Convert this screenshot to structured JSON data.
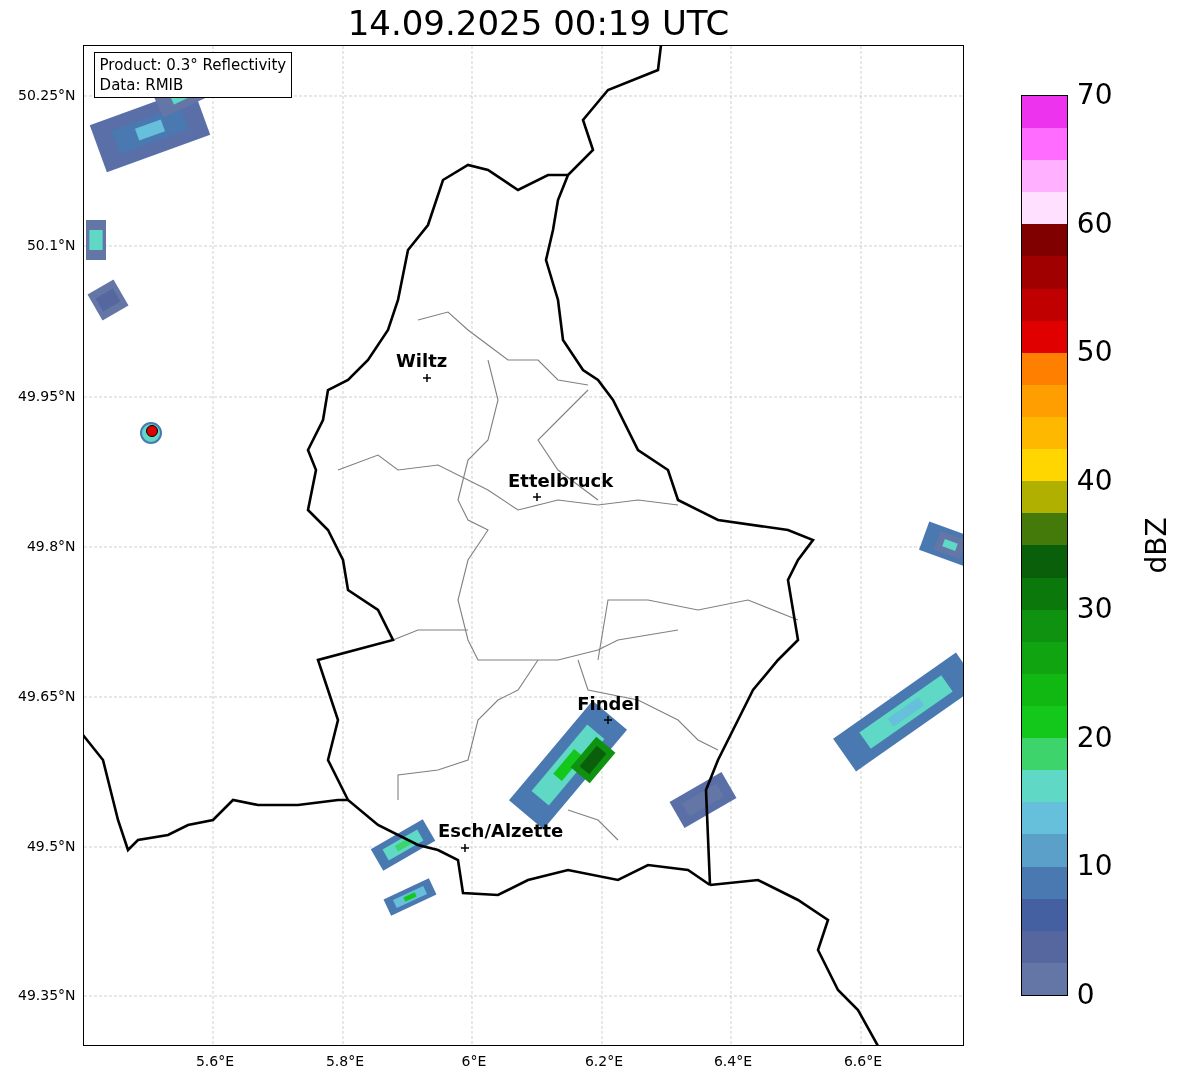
{
  "title": "14.09.2025 00:19 UTC",
  "info_box": {
    "lines": [
      "Product: 0.3° Reflectivity",
      "Data: RMIB"
    ]
  },
  "y_ticks": [
    "50.25°N",
    "50.1°N",
    "49.95°N",
    "49.8°N",
    "49.65°N",
    "49.5°N",
    "49.35°N"
  ],
  "x_ticks": [
    "5.6°E",
    "5.8°E",
    "6°E",
    "6.2°E",
    "6.4°E",
    "6.6°E"
  ],
  "cities": [
    {
      "name": "Wiltz"
    },
    {
      "name": "Ettelbruck"
    },
    {
      "name": "Findel"
    },
    {
      "name": "Esch/Alzette"
    }
  ],
  "colorbar": {
    "label": "dBZ",
    "ticks": [
      "70",
      "60",
      "50",
      "40",
      "30",
      "20",
      "10",
      "0"
    ],
    "segments": [
      {
        "color": "#6476a6"
      },
      {
        "color": "#56679f"
      },
      {
        "color": "#4560a0"
      },
      {
        "color": "#4a78b0"
      },
      {
        "color": "#5aa0c8"
      },
      {
        "color": "#66c0dc"
      },
      {
        "color": "#5fd8c6"
      },
      {
        "color": "#3ed46c"
      },
      {
        "color": "#13c81a"
      },
      {
        "color": "#12b812"
      },
      {
        "color": "#10a510"
      },
      {
        "color": "#0f920f"
      },
      {
        "color": "#0b780b"
      },
      {
        "color": "#0a600a"
      },
      {
        "color": "#437a0a"
      },
      {
        "color": "#b0b000"
      },
      {
        "color": "#ffd600"
      },
      {
        "color": "#ffb800"
      },
      {
        "color": "#ff9e00"
      },
      {
        "color": "#ff7f00"
      },
      {
        "color": "#e10000"
      },
      {
        "color": "#c00000"
      },
      {
        "color": "#a00000"
      },
      {
        "color": "#800000"
      },
      {
        "color": "#ffe0ff"
      },
      {
        "color": "#ffb0ff"
      },
      {
        "color": "#ff6cff"
      },
      {
        "color": "#ee33ee"
      }
    ]
  }
}
